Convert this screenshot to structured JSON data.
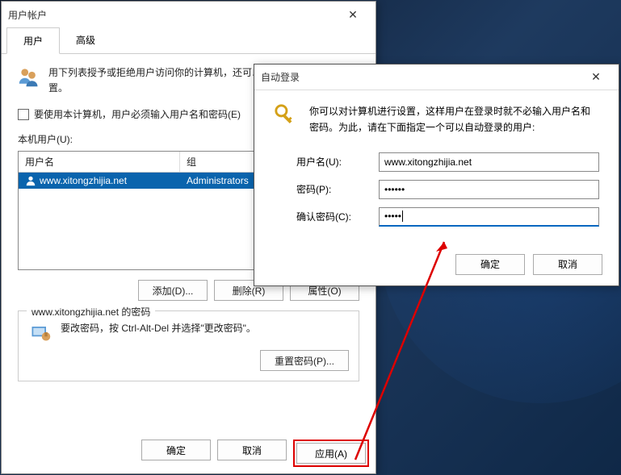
{
  "main_window": {
    "title": "用户帐户",
    "tabs": {
      "users": "用户",
      "advanced": "高级"
    },
    "description": "用下列表授予或拒绝用户访问你的计算机，还可以更改其密码和其他设置。",
    "checkbox_label": "要使用本计算机，用户必须输入用户名和密码(E)",
    "users_list_label": "本机用户(U):",
    "table": {
      "col_user": "用户名",
      "col_group": "组",
      "rows": [
        {
          "user": "www.xitongzhijia.net",
          "group": "Administrators"
        }
      ]
    },
    "buttons": {
      "add": "添加(D)...",
      "delete": "删除(R)",
      "props": "属性(O)"
    },
    "password_box": {
      "legend": "www.xitongzhijia.net 的密码",
      "text": "要改密码，按 Ctrl-Alt-Del 并选择\"更改密码\"。",
      "reset": "重置密码(P)..."
    },
    "footer": {
      "ok": "确定",
      "cancel": "取消",
      "apply": "应用(A)"
    }
  },
  "auto_login": {
    "title": "自动登录",
    "description": "你可以对计算机进行设置，这样用户在登录时就不必输入用户名和密码。为此，请在下面指定一个可以自动登录的用户:",
    "fields": {
      "username_label": "用户名(U):",
      "username_value": "www.xitongzhijia.net",
      "password_label": "密码(P):",
      "password_value": "••••••",
      "confirm_label": "确认密码(C):",
      "confirm_value": "•••••"
    },
    "buttons": {
      "ok": "确定",
      "cancel": "取消"
    }
  }
}
